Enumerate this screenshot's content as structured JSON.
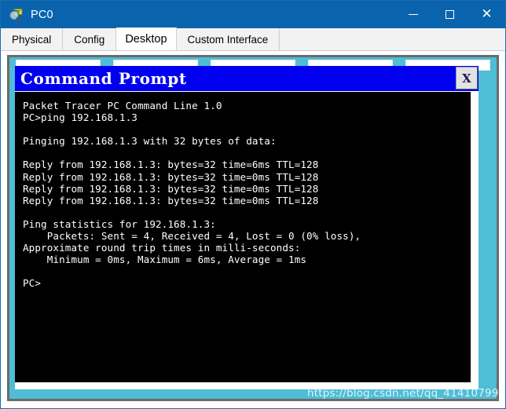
{
  "window": {
    "title": "PC0",
    "icon": "packet-tracer-magnifier-icon",
    "controls": {
      "minimize_label": "—",
      "maximize_label": "□",
      "close_label": "✕"
    },
    "colors": {
      "title_bar": "#0a64ad",
      "desktop": "#4ebdd6",
      "cmd_title_bar": "#0000ee",
      "terminal_bg": "#000000",
      "terminal_fg": "#ffffff",
      "bezel": "#6b6b6b"
    }
  },
  "tabs": [
    {
      "label": "Physical",
      "active": false
    },
    {
      "label": "Config",
      "active": false
    },
    {
      "label": "Desktop",
      "active": true
    },
    {
      "label": "Custom Interface",
      "active": false
    }
  ],
  "desktop": {
    "icon_panels": [
      {
        "name": "desktop-app-panel-1"
      },
      {
        "name": "desktop-app-panel-2"
      },
      {
        "name": "desktop-app-panel-3"
      },
      {
        "name": "desktop-app-panel-4"
      },
      {
        "name": "desktop-app-panel-5"
      }
    ]
  },
  "command_prompt": {
    "title": "Command Prompt",
    "close_label": "X",
    "terminal_lines": [
      "Packet Tracer PC Command Line 1.0",
      "PC>ping 192.168.1.3",
      "",
      "Pinging 192.168.1.3 with 32 bytes of data:",
      "",
      "Reply from 192.168.1.3: bytes=32 time=6ms TTL=128",
      "Reply from 192.168.1.3: bytes=32 time=0ms TTL=128",
      "Reply from 192.168.1.3: bytes=32 time=0ms TTL=128",
      "Reply from 192.168.1.3: bytes=32 time=0ms TTL=128",
      "",
      "Ping statistics for 192.168.1.3:",
      "    Packets: Sent = 4, Received = 4, Lost = 0 (0% loss),",
      "Approximate round trip times in milli-seconds:",
      "    Minimum = 0ms, Maximum = 6ms, Average = 1ms",
      "",
      "PC>"
    ],
    "ping_result": {
      "target": "192.168.1.3",
      "bytes": 32,
      "replies": [
        {
          "time_ms": 6,
          "ttl": 128,
          "bytes": 32
        },
        {
          "time_ms": 0,
          "ttl": 128,
          "bytes": 32
        },
        {
          "time_ms": 0,
          "ttl": 128,
          "bytes": 32
        },
        {
          "time_ms": 0,
          "ttl": 128,
          "bytes": 32
        }
      ],
      "sent": 4,
      "received": 4,
      "lost": 0,
      "loss_percent": 0,
      "minimum_ms": 0,
      "maximum_ms": 6,
      "average_ms": 1,
      "version": "Packet Tracer PC Command Line 1.0"
    }
  },
  "watermark": {
    "text": "https://blog.csdn.net/qq_41410799"
  }
}
